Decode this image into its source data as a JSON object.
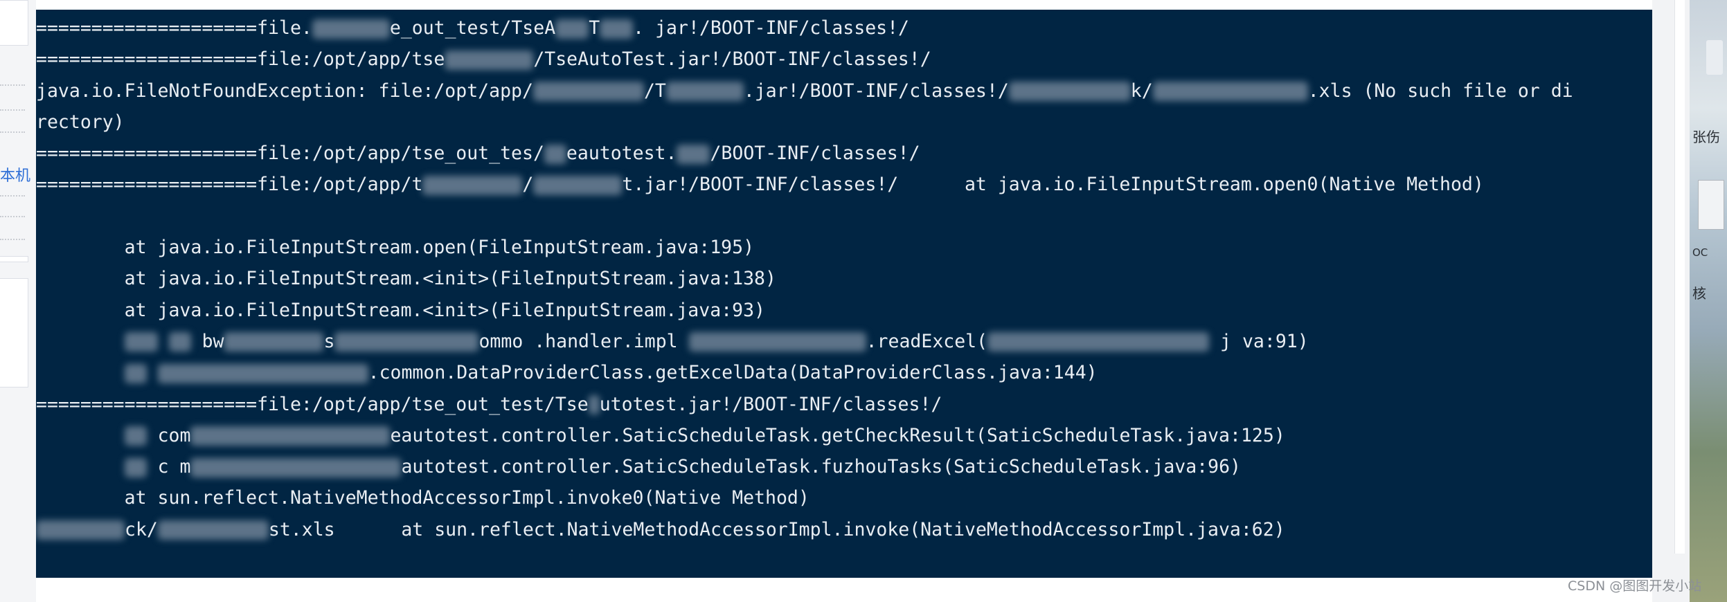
{
  "side_panel": {
    "label": "本机"
  },
  "right_panel": {
    "label_1": "张伤",
    "label_2": "OC",
    "label_3": "核"
  },
  "watermark": "CSDN @图图开发小站",
  "terminal": {
    "lines": [
      [
        {
          "t": "====================file."
        },
        {
          "b": 7
        },
        {
          "t": "e_out_test/TseA"
        },
        {
          "b": 3
        },
        {
          "t": "T"
        },
        {
          "b": 3
        },
        {
          "t": ". jar!/BOOT-INF/classes!/"
        }
      ],
      [
        {
          "t": "====================file:/opt/app/tse"
        },
        {
          "b": 8
        },
        {
          "t": "/TseAutoTest.jar!/BOOT-INF/classes!/"
        }
      ],
      [
        {
          "t": "java.io.FileNotFoundException: file:/opt/app/"
        },
        {
          "b": 10
        },
        {
          "t": "/T"
        },
        {
          "b": 7
        },
        {
          "t": ".jar!/BOOT-INF/classes!/"
        },
        {
          "b": 11
        },
        {
          "t": "k/"
        },
        {
          "b": 14
        },
        {
          "t": ".xls (No such file or di"
        }
      ],
      [
        {
          "t": "rectory)"
        }
      ],
      [
        {
          "t": "====================file:/opt/app/tse_out_tes/"
        },
        {
          "b": 2
        },
        {
          "t": "eautotest."
        },
        {
          "b": 3
        },
        {
          "t": "/BOOT-INF/classes!/"
        }
      ],
      [
        {
          "t": "====================file:/opt/app/t"
        },
        {
          "b": 9
        },
        {
          "t": "/"
        },
        {
          "b": 8
        },
        {
          "t": "t.jar!/BOOT-INF/classes!/      at java.io.FileInputStream.open0(Native Method)"
        }
      ],
      [
        {
          "t": ""
        }
      ],
      [
        {
          "t": "        at java.io.FileInputStream.open(FileInputStream.java:195)"
        }
      ],
      [
        {
          "t": "        at java.io.FileInputStream.<init>(FileInputStream.java:138)"
        }
      ],
      [
        {
          "t": "        at java.io.FileInputStream.<init>(FileInputStream.java:93)"
        }
      ],
      [
        {
          "t": "        "
        },
        {
          "b": 3
        },
        {
          "t": " "
        },
        {
          "b": 2
        },
        {
          "t": " bw"
        },
        {
          "b": 9
        },
        {
          "t": "s"
        },
        {
          "b": 13
        },
        {
          "t": "ommo .handler.impl "
        },
        {
          "b": 16
        },
        {
          "t": ".readExcel("
        },
        {
          "b": 20
        },
        {
          "t": " j va:91)"
        }
      ],
      [
        {
          "t": "        "
        },
        {
          "b": 2
        },
        {
          "t": " "
        },
        {
          "b": 19
        },
        {
          "t": ".common.DataProviderClass.getExcelData(DataProviderClass.java:144)"
        }
      ],
      [
        {
          "t": "====================file:/opt/app/tse_out_test/Tse"
        },
        {
          "b": 1
        },
        {
          "t": "utotest.jar!/BOOT-INF/classes!/"
        }
      ],
      [
        {
          "t": "        "
        },
        {
          "b": 2
        },
        {
          "t": " com"
        },
        {
          "b": 18
        },
        {
          "t": "eautotest.controller.SaticScheduleTask.getCheckResult(SaticScheduleTask.java:125)"
        }
      ],
      [
        {
          "t": "        "
        },
        {
          "b": 2
        },
        {
          "t": " c m"
        },
        {
          "b": 19
        },
        {
          "t": "autotest.controller.SaticScheduleTask.fuzhouTasks(SaticScheduleTask.java:96)"
        }
      ],
      [
        {
          "t": "        at sun.reflect.NativeMethodAccessorImpl.invoke0(Native Method)"
        }
      ],
      [
        {
          "b": 8
        },
        {
          "t": "ck/"
        },
        {
          "b": 10
        },
        {
          "t": "st.xls      at sun.reflect.NativeMethodAccessorImpl.invoke(NativeMethodAccessorImpl.java:62)"
        }
      ]
    ]
  }
}
